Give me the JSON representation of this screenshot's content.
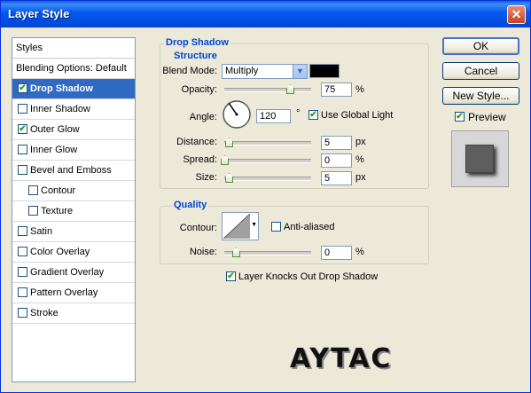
{
  "window": {
    "title": "Layer Style",
    "close_glyph": "✕"
  },
  "styles_panel": {
    "header": "Styles",
    "blending_options": "Blending Options: Default",
    "items": [
      {
        "label": "Drop Shadow",
        "checked": true,
        "selected": true,
        "indent": false
      },
      {
        "label": "Inner Shadow",
        "checked": false,
        "selected": false,
        "indent": false
      },
      {
        "label": "Outer Glow",
        "checked": true,
        "selected": false,
        "indent": false
      },
      {
        "label": "Inner Glow",
        "checked": false,
        "selected": false,
        "indent": false
      },
      {
        "label": "Bevel and Emboss",
        "checked": false,
        "selected": false,
        "indent": false
      },
      {
        "label": "Contour",
        "checked": false,
        "selected": false,
        "indent": true
      },
      {
        "label": "Texture",
        "checked": false,
        "selected": false,
        "indent": true
      },
      {
        "label": "Satin",
        "checked": false,
        "selected": false,
        "indent": false
      },
      {
        "label": "Color Overlay",
        "checked": false,
        "selected": false,
        "indent": false
      },
      {
        "label": "Gradient Overlay",
        "checked": false,
        "selected": false,
        "indent": false
      },
      {
        "label": "Pattern Overlay",
        "checked": false,
        "selected": false,
        "indent": false
      },
      {
        "label": "Stroke",
        "checked": false,
        "selected": false,
        "indent": false
      }
    ]
  },
  "drop_shadow": {
    "title": "Drop Shadow",
    "structure": {
      "title": "Structure",
      "blend_mode_label": "Blend Mode:",
      "blend_mode_value": "Multiply",
      "shadow_color": "#000000",
      "opacity_label": "Opacity:",
      "opacity_value": "75",
      "opacity_unit": "%",
      "angle_label": "Angle:",
      "angle_value": "120",
      "angle_unit": "°",
      "use_global_light_label": "Use Global Light",
      "use_global_light_checked": true,
      "distance_label": "Distance:",
      "distance_value": "5",
      "distance_unit": "px",
      "spread_label": "Spread:",
      "spread_value": "0",
      "spread_unit": "%",
      "size_label": "Size:",
      "size_value": "5",
      "size_unit": "px"
    },
    "quality": {
      "title": "Quality",
      "contour_label": "Contour:",
      "anti_aliased_label": "Anti-aliased",
      "anti_aliased_checked": false,
      "noise_label": "Noise:",
      "noise_value": "0",
      "noise_unit": "%"
    },
    "knockout_label": "Layer Knocks Out Drop Shadow",
    "knockout_checked": true
  },
  "buttons": {
    "ok": "OK",
    "cancel": "Cancel",
    "new_style": "New Style..."
  },
  "preview": {
    "label": "Preview",
    "checked": true
  },
  "watermark": "AYTAC",
  "colors": {
    "title_bar": "#0058ee",
    "selection": "#316ac5",
    "group_title": "#0046d5",
    "check": "#21a121"
  }
}
